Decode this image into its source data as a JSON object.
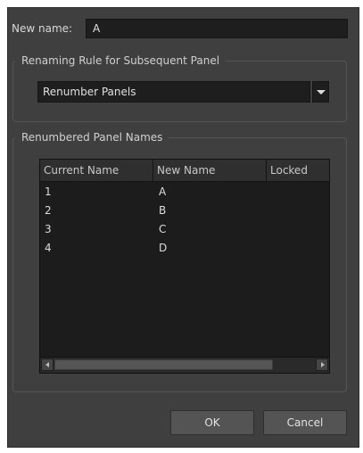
{
  "form": {
    "new_name_label": "New name:",
    "new_name_value": "A"
  },
  "renaming_rule": {
    "title": "Renaming Rule for Subsequent Panel",
    "selected": "Renumber Panels"
  },
  "renumbered": {
    "title": "Renumbered Panel Names",
    "columns": [
      "Current Name",
      "New Name",
      "Locked"
    ],
    "rows": [
      {
        "current": "1",
        "new": "A",
        "locked": ""
      },
      {
        "current": "2",
        "new": "B",
        "locked": ""
      },
      {
        "current": "3",
        "new": "C",
        "locked": ""
      },
      {
        "current": "4",
        "new": "D",
        "locked": ""
      }
    ]
  },
  "buttons": {
    "ok": "OK",
    "cancel": "Cancel"
  }
}
